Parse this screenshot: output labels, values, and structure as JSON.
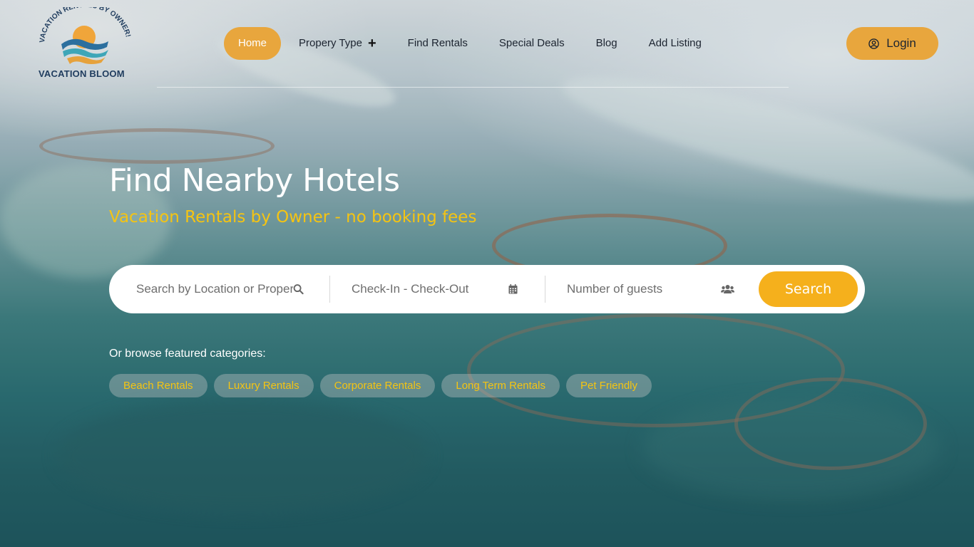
{
  "logo": {
    "arc_text": "VACATION RENTALS BY OWNER!",
    "name": "VACATION BLOOM"
  },
  "nav": {
    "items": [
      {
        "label": "Home",
        "active": true
      },
      {
        "label": "Propery Type",
        "has_plus": true
      },
      {
        "label": "Find Rentals"
      },
      {
        "label": "Special Deals"
      },
      {
        "label": "Blog"
      },
      {
        "label": "Add Listing"
      }
    ]
  },
  "login": {
    "label": "Login",
    "icon": "user-circle-icon"
  },
  "hero": {
    "title": "Find Nearby Hotels",
    "subtitle": "Vacation Rentals by Owner - no booking fees"
  },
  "search": {
    "location_placeholder": "Search by Location or Property",
    "dates_placeholder": "Check-In - Check-Out",
    "guests_placeholder": "Number of guests",
    "button_label": "Search"
  },
  "categories": {
    "label": "Or browse featured categories:",
    "items": [
      "Beach Rentals",
      "Luxury Rentals",
      "Corporate Rentals",
      "Long Term Rentals",
      "Pet Friendly"
    ]
  },
  "colors": {
    "accent": "#e8a63d",
    "search_button": "#f5b01c",
    "subtitle": "#f5c412",
    "chip_text": "#f5c412"
  }
}
